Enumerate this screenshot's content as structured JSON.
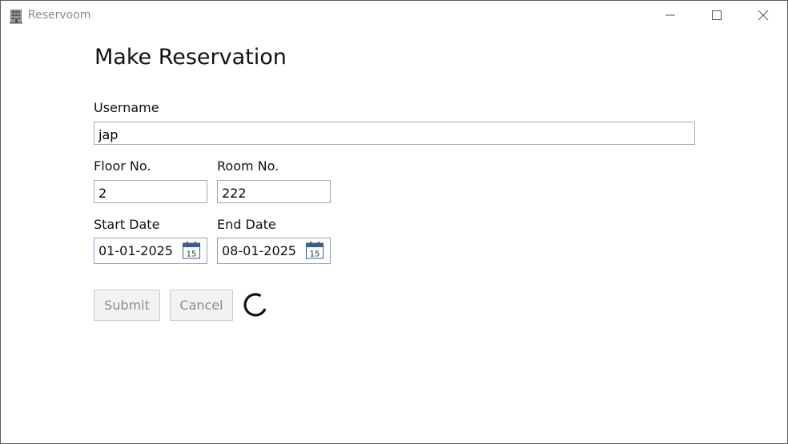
{
  "window": {
    "title": "Reservoom",
    "icons": {
      "app": "building-icon",
      "minimize": "minimize-icon",
      "maximize": "maximize-icon",
      "close": "close-icon"
    }
  },
  "form": {
    "heading": "Make Reservation",
    "username": {
      "label": "Username",
      "value": "jap"
    },
    "floor": {
      "label": "Floor No.",
      "value": "2"
    },
    "room": {
      "label": "Room No.",
      "value": "222"
    },
    "start_date": {
      "label": "Start Date",
      "value": "01-01-2025",
      "calendar_day": "15"
    },
    "end_date": {
      "label": "End Date",
      "value": "08-01-2025",
      "calendar_day": "15"
    },
    "buttons": {
      "submit": "Submit",
      "cancel": "Cancel"
    },
    "spinner_icon": "loading-spinner-icon"
  }
}
